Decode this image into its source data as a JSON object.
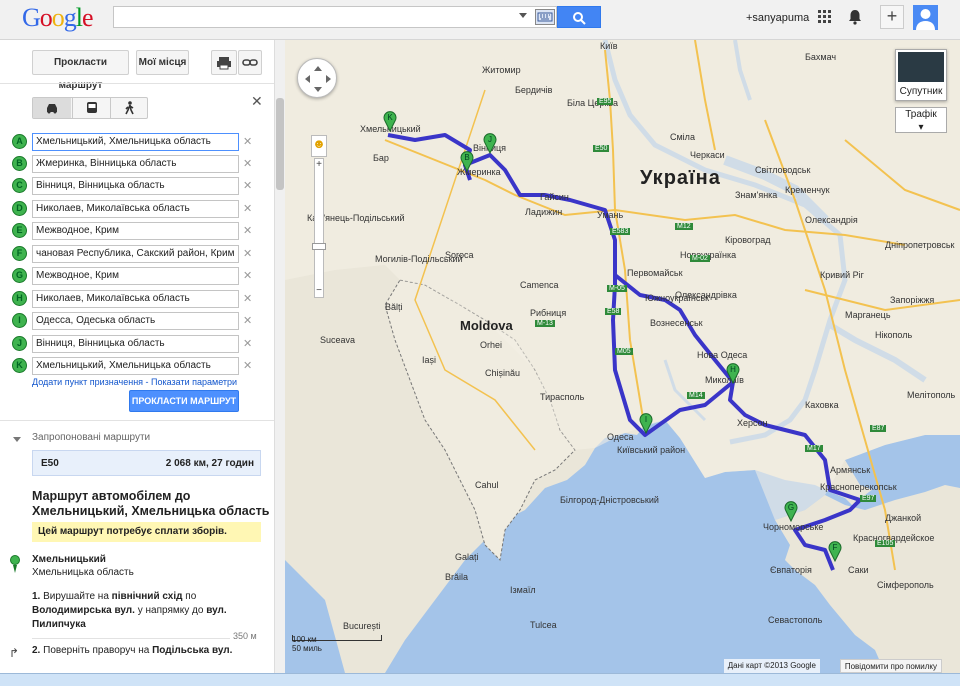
{
  "header": {
    "logo_letters": [
      "G",
      "o",
      "o",
      "g",
      "l",
      "e"
    ],
    "search_value": "",
    "user": "+sanyapuma"
  },
  "toolbar": {
    "route_button": "Прокласти маршрут",
    "my_places": "Мої місця"
  },
  "travel_modes": [
    "car",
    "bus",
    "walk"
  ],
  "waypoints": [
    {
      "letter": "A",
      "value": "Хмельницький, Хмельницька область"
    },
    {
      "letter": "B",
      "value": "Жмеринка, Вінницька область"
    },
    {
      "letter": "C",
      "value": "Вінниця, Вінницька область"
    },
    {
      "letter": "D",
      "value": "Николаев, Миколаївська область"
    },
    {
      "letter": "E",
      "value": "Межводное, Крим"
    },
    {
      "letter": "F",
      "value": "чановая Республика, Сакский район, Крим"
    },
    {
      "letter": "G",
      "value": "Межводное, Крим"
    },
    {
      "letter": "H",
      "value": "Николаев, Миколаївська область"
    },
    {
      "letter": "I",
      "value": "Одесса, Одеська область"
    },
    {
      "letter": "J",
      "value": "Вінниця, Вінницька область"
    },
    {
      "letter": "K",
      "value": "Хмельницький, Хмельницька область"
    }
  ],
  "links": {
    "add_destination": "Додати пункт призначення",
    "separator": " - ",
    "show_options": "Показати параметри"
  },
  "route_submit": "ПРОКЛАСТИ МАРШРУТ",
  "suggested": {
    "label": "Запропоновані маршрути",
    "route_name": "E50",
    "route_summary": "2 068 км, 27 годин"
  },
  "directions": {
    "title": "Маршрут автомобілем до Хмельницький, Хмельницька область",
    "toll_notice": "Цей маршрут потребує сплати зборів.",
    "start_name": "Хмельницький",
    "start_region": "Хмельницька область",
    "step1_num": "1.",
    "step1_a": "Вирушайте на ",
    "step1_b": "північний схід",
    "step1_c": " по ",
    "step1_d": "Володимирська вул.",
    "step1_e": " у напрямку до ",
    "step1_f": "вул. Пилипчука",
    "step1_dist": "350 м",
    "step2_num": "2.",
    "step2_a": "Поверніть праворуч на ",
    "step2_b": "Подільська вул."
  },
  "map": {
    "country_big": "Україна",
    "moldova": "Moldova",
    "satellite": "Супутник",
    "traffic": "Трафік",
    "scale_km": "100 км",
    "scale_mi": "50 миль",
    "attribution": "Дані карт ©2013 Google",
    "report": "Повідомити про помилку",
    "route_color": "#3a35c8",
    "cities": [
      {
        "name": "Хмельницький"
      },
      {
        "name": "Вінниця"
      },
      {
        "name": "Жмеринка"
      },
      {
        "name": "Київ"
      },
      {
        "name": "Житомир"
      },
      {
        "name": "Черкаси"
      },
      {
        "name": "Кременчук"
      },
      {
        "name": "Кіровоград"
      },
      {
        "name": "Умань"
      },
      {
        "name": "Гайсин"
      },
      {
        "name": "Ладижин"
      },
      {
        "name": "Первомайськ"
      },
      {
        "name": "Южноукраїнськ"
      },
      {
        "name": "Вознесенськ"
      },
      {
        "name": "Нова Одеса"
      },
      {
        "name": "Миколаїв"
      },
      {
        "name": "Херсон"
      },
      {
        "name": "Одеса"
      },
      {
        "name": "Київський район"
      },
      {
        "name": "Chișinău"
      },
      {
        "name": "Iași"
      },
      {
        "name": "Bălți"
      },
      {
        "name": "Suceava"
      },
      {
        "name": "Кривий Ріг"
      },
      {
        "name": "Дніпропетровськ"
      },
      {
        "name": "Запоріжжя"
      },
      {
        "name": "Мелітополь"
      },
      {
        "name": "Нікополь"
      },
      {
        "name": "Марганець"
      },
      {
        "name": "Каховка"
      },
      {
        "name": "Армянськ"
      },
      {
        "name": "Красноперекопськ"
      },
      {
        "name": "Джанкой"
      },
      {
        "name": "Чорноморське"
      },
      {
        "name": "Євпаторія"
      },
      {
        "name": "Саки"
      },
      {
        "name": "Сімферополь"
      },
      {
        "name": "Севастополь"
      },
      {
        "name": "Красногвардейское"
      },
      {
        "name": "Бар"
      },
      {
        "name": "Кам'янець-Подільський"
      },
      {
        "name": "Могилів-Подільський"
      },
      {
        "name": "Ізмаїл"
      },
      {
        "name": "Білгород-Дністровський"
      },
      {
        "name": "Бердичів"
      },
      {
        "name": "Біла Церква"
      },
      {
        "name": "Олександрія"
      },
      {
        "name": "Знам'янка"
      },
      {
        "name": "Новоукраїнка"
      },
      {
        "name": "Олександрівка"
      },
      {
        "name": "Світловодськ"
      },
      {
        "name": "Смiла"
      },
      {
        "name": "Бахмач"
      },
      {
        "name": "București"
      },
      {
        "name": "Galați"
      },
      {
        "name": "Brăila"
      },
      {
        "name": "Tulcea"
      },
      {
        "name": "Camenca"
      },
      {
        "name": "Рибниця"
      },
      {
        "name": "Тирасполь"
      },
      {
        "name": "Cahul"
      },
      {
        "name": "Orhei"
      },
      {
        "name": "Soroca"
      }
    ],
    "road_labels": [
      "E50",
      "E95",
      "M12",
      "M-05",
      "M-13",
      "E58",
      "E583",
      "E97",
      "M14",
      "M05",
      "E105",
      "M17",
      "E87",
      "M-02"
    ],
    "markers": [
      "K",
      "J",
      "B",
      "H",
      "I",
      "G",
      "F"
    ]
  }
}
